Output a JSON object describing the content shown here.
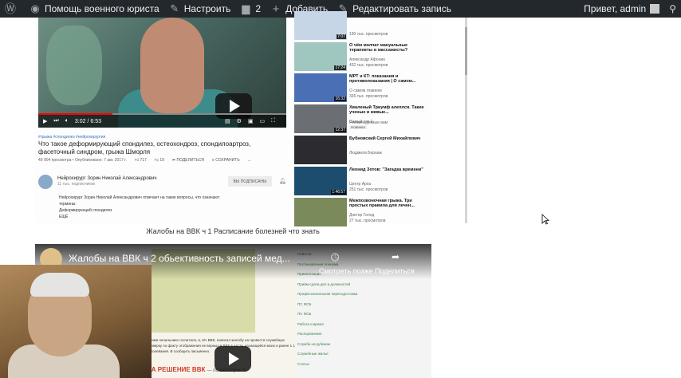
{
  "admin_bar": {
    "wp_logo_icon": "wordpress-icon",
    "site_name": "Помощь военного юриста",
    "customize": "Настроить",
    "comments_count": "2",
    "add_new": "Добавить",
    "edit_post": "Редактировать запись",
    "greeting": "Привет, admin",
    "search_icon": "search-icon"
  },
  "video1": {
    "hashtags": "#грыжа #спондилез #нейрохирургия",
    "title": "Что такое деформирующий спондилез, остеохондроз, спондилоартроз, фасеточный синдром, грыжа Шморля",
    "time": "3:02 / 6:53",
    "views_date": "49 904 просмотра • Опубликовано: 7 авг. 2017 г.",
    "likes": "717",
    "dislikes": "19",
    "share": "ПОДЕЛИТЬСЯ",
    "save": "СОХРАНИТЬ",
    "more": "...",
    "channel_name": "Нейрохирург Зорин Николай Александрович",
    "channel_subs": "11 тыс. подписчиков",
    "subscribed": "ВЫ ПОДПИСАНЫ",
    "description_lines": [
      "Нейрохирург Зорин Николай Александрович отвечает на такие вопросы, что означают",
      "термины:",
      "Деформирующий спондилез",
      "ЕЩЁ"
    ]
  },
  "sidebar_videos": [
    {
      "title": "",
      "channel": "",
      "views": "190 тыс. просмотров",
      "duration": "7:07",
      "thumb_color": "#c7d6e6"
    },
    {
      "title": "О чём молчат мануальные терапевты и массажисты?",
      "channel": "Александр Афонин",
      "views": "432 тыс. просмотров",
      "duration": "17:24",
      "thumb_color": "#9fc7c0"
    },
    {
      "title": "МРТ и КТ: показания и противопоказания | О самом...",
      "channel": "О самом главном",
      "views": "326 тыс. просмотров",
      "duration": "16:32",
      "thumb_color": "#4a6fb5"
    },
    {
      "title": "Хваленый Триумф алеплся. Такие ученые и живые...",
      "channel": "Самый сок 2",
      "views": "Рекомендуемые вам",
      "badge": "Новинка",
      "duration": "12:37",
      "thumb_color": "#6b6f74"
    },
    {
      "title": "Бубновский Сергей Михайлович",
      "channel": "Людмила Бернаж",
      "views": "",
      "duration": "",
      "thumb_color": "#2b2b30"
    },
    {
      "title": "Леонид Зотов: \"Загадка времени\"",
      "channel": "Центр Арха",
      "views": "251 тыс. просмотров",
      "duration": "1:46:57",
      "thumb_color": "#1d4d6e"
    },
    {
      "title": "Межпозвоночная грыжа. Три простых правила для лечен...",
      "channel": "Доктор Голод",
      "views": "27 тыс. просмотров",
      "duration": "",
      "thumb_color": "#7a8a5a"
    }
  ],
  "caption1": "Жалобы на ВВК ч 1 Расписание болезней что знать",
  "video2": {
    "title": "Жалобы на ВВК ч 2 обьективность записей мед...",
    "watch_later": "Смотреть позже",
    "share": "Поделиться",
    "menu_items": [
      "Новости",
      "Постановления пленума",
      "Приватизация",
      "Прийм-сдача дел и должностей",
      "Профессиональная переподготовка",
      "ПС ФСБ",
      "ПС ФСБ",
      "Работа и время",
      "Распоряжения",
      "Служба на рубежах",
      "Служебные жилье",
      "Статьи"
    ],
    "doc_text": "на имя начальника госпиталя, а, в/ч ВВК, написал жалобу на провести служебную проверку по факту отображения не верных в ВВК в части, касающейся моих и ранее 1 1 заболевания. В сообщить письменно.",
    "decision": "НА РЕШЕНИЕ ВВК",
    "decision_suffix": "— по категории Б"
  },
  "colors": {
    "admin_bar_bg": "#23282d",
    "accent_red": "#ff0000"
  }
}
